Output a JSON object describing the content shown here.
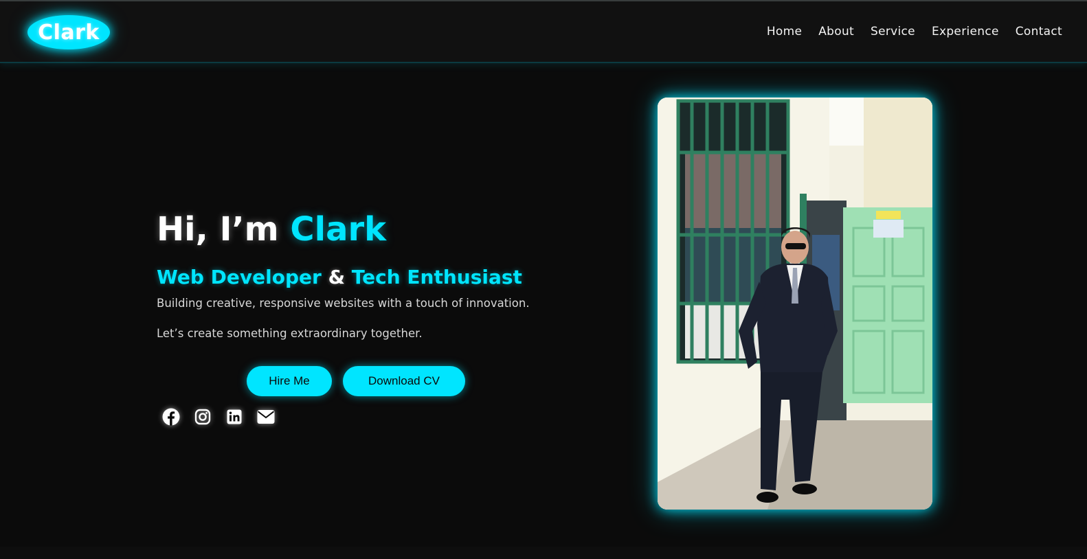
{
  "logo": {
    "text": "Clark"
  },
  "nav": {
    "items": [
      {
        "label": "Home"
      },
      {
        "label": "About"
      },
      {
        "label": "Service"
      },
      {
        "label": "Experience"
      },
      {
        "label": "Contact"
      }
    ]
  },
  "hero": {
    "greeting": "Hi, I’m ",
    "name": "Clark",
    "role_part1": "Web Developer",
    "role_amp": " & ",
    "role_part2": "Tech Enthusiast",
    "description_1": "Building creative, responsive websites with a touch of innovation.",
    "description_2": "Let’s create something extraordinary together.",
    "hire_button": "Hire Me",
    "cv_button": "Download CV"
  },
  "socials": [
    {
      "icon": "facebook-icon"
    },
    {
      "icon": "instagram-icon"
    },
    {
      "icon": "linkedin-icon"
    },
    {
      "icon": "mail-icon"
    }
  ],
  "colors": {
    "accent": "#00e5ff",
    "background": "#0b0b0b",
    "header": "#111111"
  }
}
